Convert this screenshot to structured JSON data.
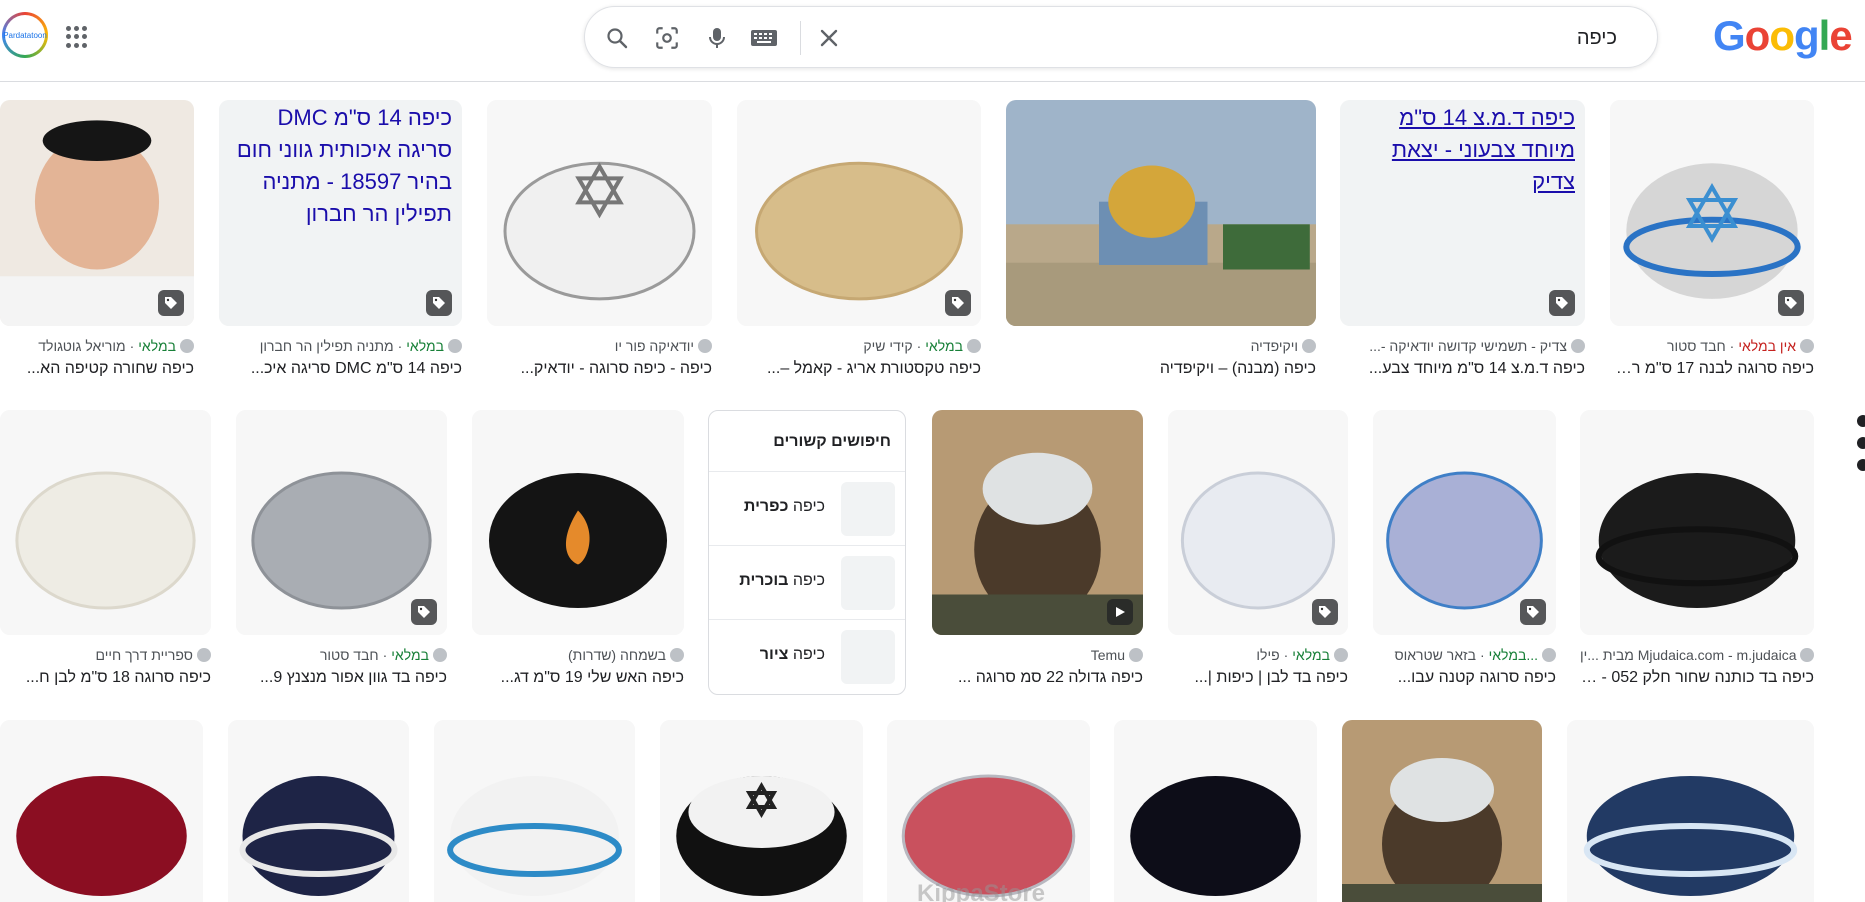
{
  "header": {
    "avatar_text": "Pardatatoon",
    "query": "כיפה",
    "logo_letters": [
      {
        "ch": "G",
        "color": "#4285f4"
      },
      {
        "ch": "o",
        "color": "#ea4335"
      },
      {
        "ch": "o",
        "color": "#fbbc05"
      },
      {
        "ch": "g",
        "color": "#4285f4"
      },
      {
        "ch": "l",
        "color": "#34a853"
      },
      {
        "ch": "e",
        "color": "#ea4335"
      }
    ],
    "icons": [
      "search-icon",
      "lens-icon",
      "mic-icon",
      "keyboard-icon",
      "clear-icon",
      "apps-icon"
    ]
  },
  "row1": [
    {
      "caption": "כיפה סרוגה לבנה 17 ס\"מ רקמ...",
      "merchant": "אין במלאי",
      "merchant_color": "red",
      "site": "חבד סטור",
      "tag": true
    },
    {
      "caption": "כיפה ד.מ.צ 14 ס\"מ מיוחד צבע...",
      "merchant": "",
      "site": "צדיק - תשמישי קדושה יודאיקה -...",
      "alt": "כיפה ד.מ.צ 14 ס\"מ מיוחד צבעוני - יצאת צדיק",
      "tag": true
    },
    {
      "caption": "כיפה (מבנה) – ויקיפדיה",
      "merchant": "",
      "site": "ויקיפדיה",
      "tag": false
    },
    {
      "caption": "כיפה טקסטורת אריג - קאמל –...",
      "merchant": "במלאי",
      "site": "קידי שיק",
      "tag": true
    },
    {
      "caption": "כיפה - כיפה סרוגה - יודאיק...",
      "merchant": "",
      "site": "יודאיקה פור יו",
      "tag": false
    },
    {
      "caption": "כיפה 14 ס\"מ DMC סריגה איכ...",
      "merchant": "במלאי",
      "site": "מתניה תפילין הר חברון",
      "alt": "כיפה 14 ס\"מ DMC סריגה איכותית גווני חום בהיר 18597 - מתניה תפילין הר חברון",
      "tag": true
    },
    {
      "caption": "כיפה שחורה קטיפה הא...",
      "merchant": "במלאי",
      "site": "מוריאל גוטגולד",
      "tag": true
    }
  ],
  "row2": [
    {
      "caption": "כיפה בד כותנה שחור חלק 052 - כי...",
      "merchant": "",
      "site": "Mjudaica.com - m.judaica מבית ...ין",
      "tag": false
    },
    {
      "caption": "כיפה סרוגה קטנה עבו...",
      "merchant": "...במלאי",
      "site": "בזאר שטראוס",
      "tag": true
    },
    {
      "caption": "כיפה בד לבן | כיפות |...",
      "merchant": "במלאי",
      "site": "פילו",
      "tag": true
    },
    {
      "caption": "כיפה גדולה 22 סמ סרוגה ...",
      "merchant": "",
      "site": "Temu",
      "tag": false,
      "play": true
    },
    {
      "caption": "כיפה האש שלי 19 ס\"מ דג...",
      "merchant": "",
      "site": "בשמחה (שדרות)",
      "tag": false
    },
    {
      "caption": "כיפה בד גוון אפור מנצנץ 9...",
      "merchant": "במלאי",
      "site": "חבד סטור",
      "tag": true
    },
    {
      "caption": "כיפה סרוגה 18 ס\"מ לבן ח...",
      "merchant": "",
      "site": "ספריית דרך חיים",
      "tag": false
    }
  ],
  "related": {
    "title": "חיפושים קשורים",
    "items": [
      {
        "prefix": "כיפה ",
        "bold": "כפרית"
      },
      {
        "prefix": "כיפה ",
        "bold": "בוכרית"
      },
      {
        "prefix": "כיפה ",
        "bold": "ציור"
      }
    ]
  },
  "row3_watermark": "KippaStore",
  "colors": {
    "link": "#1a0dab",
    "in_stock": "#188038",
    "out_of_stock": "#c5221f"
  }
}
